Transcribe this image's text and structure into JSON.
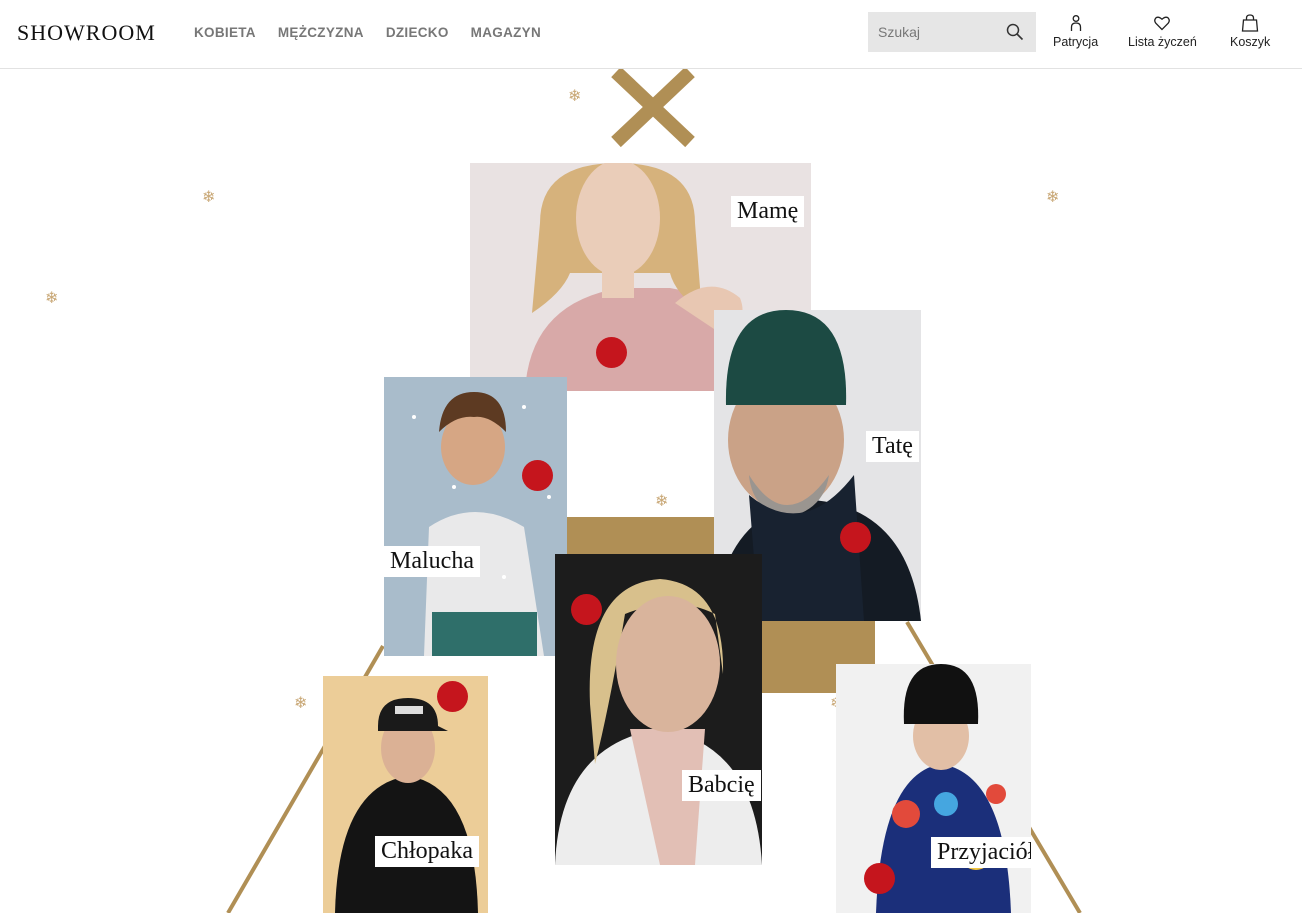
{
  "header": {
    "logo": "SHOWROOM",
    "nav": [
      "KOBIETA",
      "MĘŻCZYZNA",
      "DZIECKO",
      "MAGAZYN"
    ],
    "search": {
      "placeholder": "Szukaj"
    },
    "user_label": "Patrycja",
    "wishlist_label": "Lista życzeń",
    "cart_label": "Koszyk"
  },
  "theme": {
    "gold": "#b08f55",
    "ornament": "#c5151d",
    "flake": "#c9a877"
  },
  "tree": {
    "photos": [
      {
        "id": "mama",
        "label": "Mamę",
        "image": "woman-pink-sweater",
        "bg": "#e9e2e2"
      },
      {
        "id": "tata",
        "label": "Tatę",
        "image": "man-green-beanie",
        "bg": "#e4e4e6"
      },
      {
        "id": "maluch",
        "label": "Malucha",
        "image": "boy-snow-sweater",
        "bg": "#a9bccb"
      },
      {
        "id": "babcia",
        "label": "Babcię",
        "image": "woman-white-shirt",
        "bg": "#1c1c1c"
      },
      {
        "id": "chlopak",
        "label": "Chłopaka",
        "image": "young-man-black-hoodie",
        "bg": "#eccd98"
      },
      {
        "id": "przyjaciolka",
        "label": "Przyjaciółkę",
        "image": "woman-black-beanie",
        "bg": "#f1f1f1"
      }
    ]
  }
}
